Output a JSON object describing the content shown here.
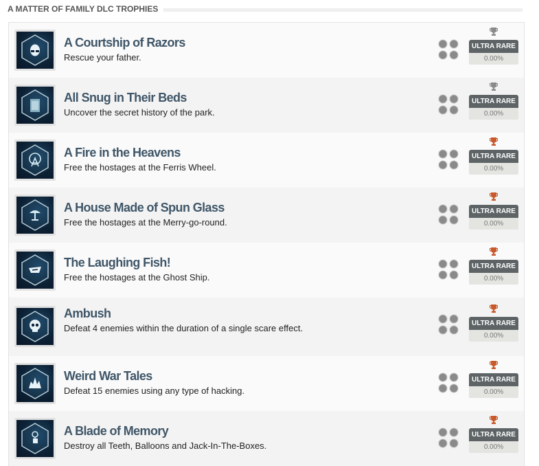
{
  "section": {
    "title": "A MATTER OF FAMILY DLC TROPHIES"
  },
  "colors": {
    "silver": "#8a8a8a",
    "bronze": "#c8592b",
    "badge_bg": "#5e6466",
    "title_text": "#3f5668"
  },
  "trophies": [
    {
      "title": "A Courtship of Razors",
      "description": "Rescue your father.",
      "tier": "silver",
      "tier_icon": "trophy-silver-icon",
      "rarity": "ULTRA RARE",
      "percent": "0.00%",
      "image_icon": "face-mask-icon"
    },
    {
      "title": "All Snug in Their Beds",
      "description": "Uncover the secret history of the park.",
      "tier": "silver",
      "tier_icon": "trophy-silver-icon",
      "rarity": "ULTRA RARE",
      "percent": "0.00%",
      "image_icon": "cabinet-icon"
    },
    {
      "title": "A Fire in the Heavens",
      "description": "Free the hostages at the Ferris Wheel.",
      "tier": "bronze",
      "tier_icon": "trophy-bronze-icon",
      "rarity": "ULTRA RARE",
      "percent": "0.00%",
      "image_icon": "ferris-wheel-icon"
    },
    {
      "title": "A House Made of Spun Glass",
      "description": "Free the hostages at the Merry-go-round.",
      "tier": "bronze",
      "tier_icon": "trophy-bronze-icon",
      "rarity": "ULTRA RARE",
      "percent": "0.00%",
      "image_icon": "carousel-icon"
    },
    {
      "title": "The Laughing Fish!",
      "description": "Free the hostages at the Ghost Ship.",
      "tier": "bronze",
      "tier_icon": "trophy-bronze-icon",
      "rarity": "ULTRA RARE",
      "percent": "0.00%",
      "image_icon": "ship-icon"
    },
    {
      "title": "Ambush",
      "description": "Defeat 4 enemies within the duration of a single scare effect.",
      "tier": "bronze",
      "tier_icon": "trophy-bronze-icon",
      "rarity": "ULTRA RARE",
      "percent": "0.00%",
      "image_icon": "skull-icon"
    },
    {
      "title": "Weird War Tales",
      "description": "Defeat 15 enemies using any type of hacking.",
      "tier": "bronze",
      "tier_icon": "trophy-bronze-icon",
      "rarity": "ULTRA RARE",
      "percent": "0.00%",
      "image_icon": "explosion-icon"
    },
    {
      "title": "A Blade of Memory",
      "description": "Destroy all Teeth, Balloons and Jack-In-The-Boxes.",
      "tier": "bronze",
      "tier_icon": "trophy-bronze-icon",
      "rarity": "ULTRA RARE",
      "percent": "0.00%",
      "image_icon": "jack-in-the-box-icon"
    }
  ]
}
